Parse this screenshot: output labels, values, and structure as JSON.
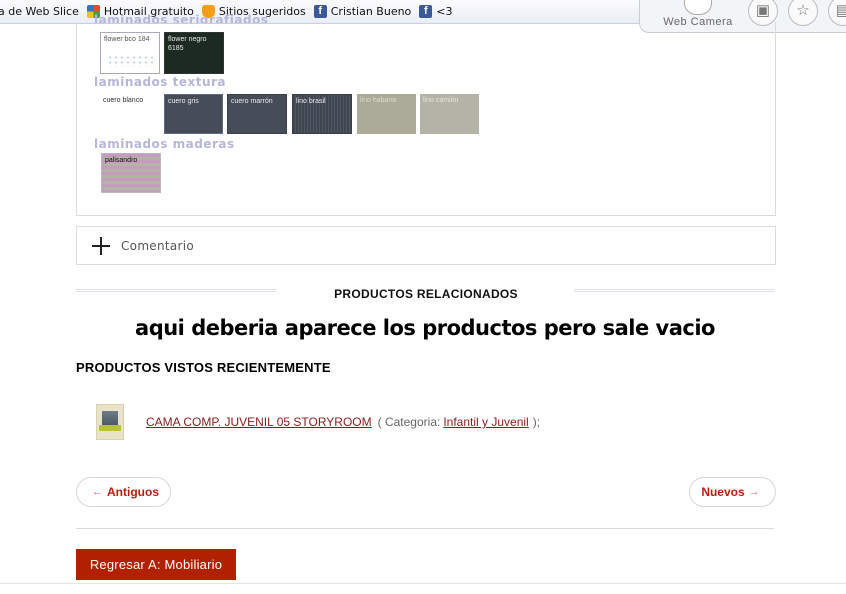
{
  "favorites": [
    {
      "label": "a de Web Slice",
      "icon": "none"
    },
    {
      "label": "Hotmail gratuito",
      "icon": "windows-flag-icon"
    },
    {
      "label": "Sitios sugeridos",
      "icon": "suggested-sites-icon"
    },
    {
      "label": "Cristian Bueno",
      "icon": "facebook-icon"
    },
    {
      "label": "<3",
      "icon": "facebook-icon"
    }
  ],
  "toolbar": {
    "webcam_label": "Web Camera"
  },
  "laminados": {
    "serigrafiados_title": "laminados serigrafiados",
    "serigrafiados": [
      {
        "name": "flower bco 184"
      },
      {
        "name": "flower negro 6185"
      }
    ],
    "textura_title": "laminados textura",
    "textura": [
      {
        "name": "cuero blanco"
      },
      {
        "name": "cuero gris"
      },
      {
        "name": "cuero marrón"
      },
      {
        "name": "lino brasil"
      },
      {
        "name": "lino habana"
      },
      {
        "name": "lino camión"
      }
    ],
    "maderas_title": "laminados maderas",
    "maderas": [
      {
        "name": "palisandro"
      }
    ]
  },
  "comment": {
    "label": "Comentario"
  },
  "related": {
    "title": "PRODUCTOS RELACIONADOS",
    "annotation": "aqui deberia aparece los productos pero sale vacio"
  },
  "recent": {
    "title": "PRODUCTOS VISTOS RECIENTEMENTE",
    "item": {
      "name": "CAMA COMP. JUVENIL 05 STORYROOM",
      "category_prefix": "( Categoria:",
      "category": "Infantil y Juvenil",
      "suffix": ");"
    }
  },
  "pagination": {
    "prev": "Antiguos",
    "next": "Nuevos",
    "prev_arrow": "←",
    "next_arrow": "→"
  },
  "back_button": "Regresar A: Mobiliario"
}
